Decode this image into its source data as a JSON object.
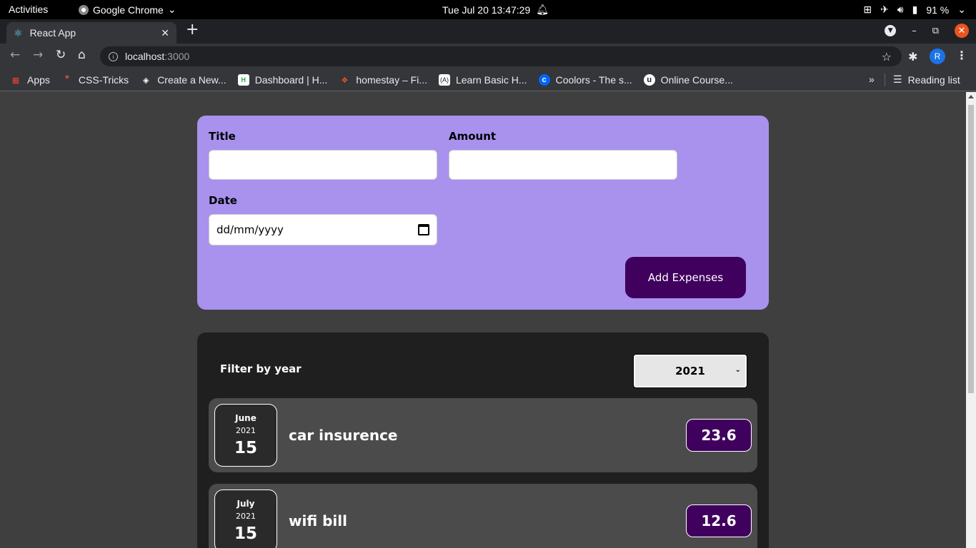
{
  "system_bar": {
    "activities": "Activities",
    "app_name": "Google Chrome",
    "clock": "Tue Jul 20  13:47:29",
    "battery": "91 %"
  },
  "browser": {
    "tab_title": "React App",
    "url_host": "localhost",
    "url_port": ":3000",
    "profile_initial": "R",
    "bookmarks": [
      {
        "label": "Apps",
        "icon": "apps-grid-icon",
        "color": "#ea4335"
      },
      {
        "label": "CSS-Tricks",
        "icon": "css-tricks-icon",
        "color": "#e8632b"
      },
      {
        "label": "Create a New...",
        "icon": "codepen-icon",
        "color": "#ffffff"
      },
      {
        "label": "Dashboard | H...",
        "icon": "hackerrank-icon",
        "color": "#1ba94c"
      },
      {
        "label": "homestay – Fi...",
        "icon": "figma-icon",
        "color": "#f24e1e"
      },
      {
        "label": "Learn Basic H...",
        "icon": "learn-icon",
        "color": "#5a5aff"
      },
      {
        "label": "Coolors - The s...",
        "icon": "coolors-icon",
        "color": "#0066ff"
      },
      {
        "label": "Online Course...",
        "icon": "udemy-icon",
        "color": "#ffffff"
      }
    ],
    "reading_list": "Reading list"
  },
  "form": {
    "title_label": "Title",
    "title_value": "",
    "amount_label": "Amount",
    "amount_value": "",
    "date_label": "Date",
    "date_placeholder": "dd/mm/yyyy",
    "submit_label": "Add Expenses"
  },
  "filter": {
    "label": "Filter by year",
    "selected_year": "2021"
  },
  "expenses": [
    {
      "month": "June",
      "year": "2021",
      "day": "15",
      "title": "car insurence",
      "amount": "23.6"
    },
    {
      "month": "July",
      "year": "2021",
      "day": "15",
      "title": "wifi bill",
      "amount": "12.6"
    }
  ],
  "colors": {
    "form_bg": "#a892ee",
    "accent": "#40005d",
    "list_bg": "#1f1f1f",
    "item_bg": "#4b4b4b",
    "page_bg": "#3f3f3f"
  }
}
